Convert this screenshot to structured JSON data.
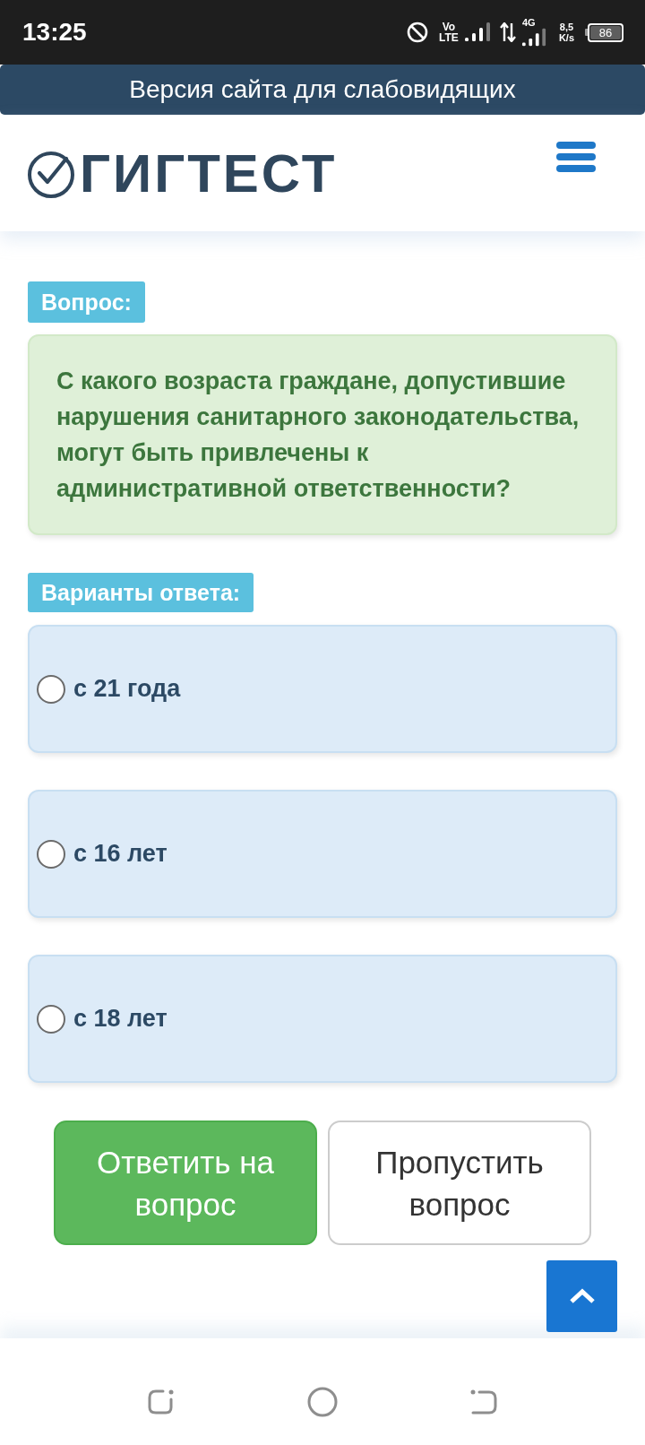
{
  "status_bar": {
    "time": "13:25",
    "volte": [
      "Vo",
      "LTE"
    ],
    "network_type": "4G",
    "speed": {
      "value": "8,5",
      "unit": "K/s"
    },
    "battery": "86"
  },
  "accessibility_link": {
    "label": "Версия сайта для слабовидящих"
  },
  "header": {
    "logo_text": "ГИГТЕСТ"
  },
  "question": {
    "heading": "Вопрос:",
    "text": "С какого возраста граждане, допустившие нарушения санитарного законодательства, могут быть привлечены к административной ответственности?"
  },
  "answers": {
    "heading": "Варианты ответа:",
    "options": [
      {
        "label": "с 21 года",
        "selected": false
      },
      {
        "label": "с 16 лет",
        "selected": false
      },
      {
        "label": "с 18 лет",
        "selected": false
      }
    ]
  },
  "actions": [
    {
      "kind": "primary",
      "label": "Ответить на вопрос"
    },
    {
      "kind": "secondary",
      "label": "Пропустить вопрос"
    }
  ]
}
